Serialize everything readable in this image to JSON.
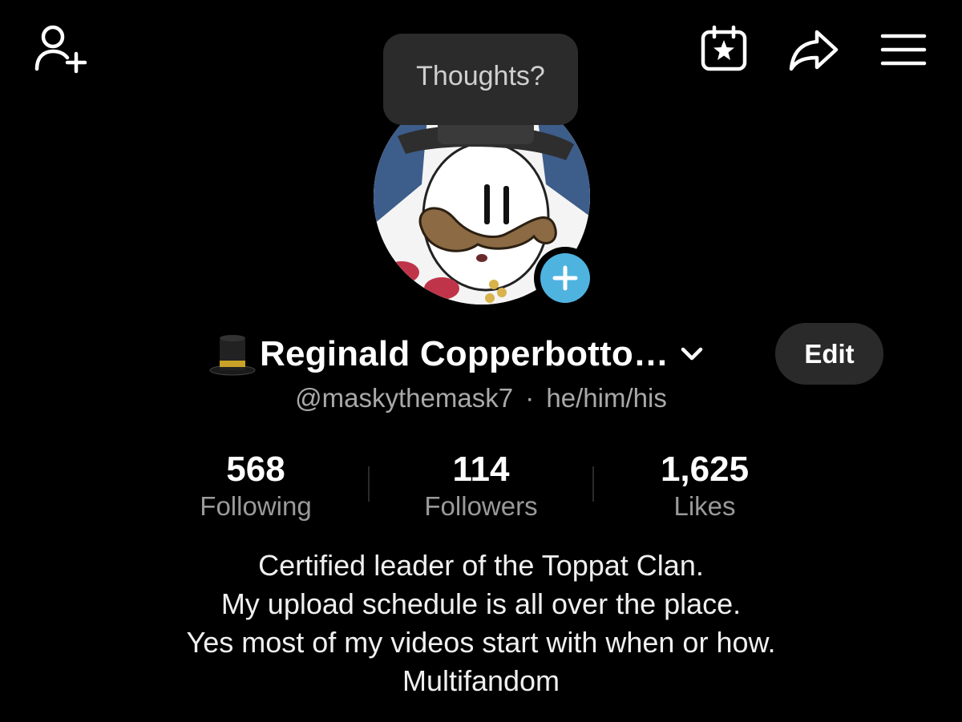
{
  "top_bar": {
    "icons": [
      "add-friend-icon",
      "calendar-star-icon",
      "share-icon",
      "menu-icon"
    ]
  },
  "thoughts_bubble": {
    "text": "Thoughts?"
  },
  "profile": {
    "name": "Reginald Copperbotto…",
    "handle": "@maskythemask7",
    "separator": "·",
    "pronouns": "he/him/his",
    "edit_label": "Edit"
  },
  "stats": [
    {
      "value": "568",
      "label": "Following"
    },
    {
      "value": "114",
      "label": "Followers"
    },
    {
      "value": "1,625",
      "label": "Likes"
    }
  ],
  "bio": [
    "Certified leader of the Toppat Clan.",
    "My upload schedule is all over the place.",
    "Yes most of my videos start with when or how.",
    "Multifandom"
  ],
  "colors": {
    "background": "#000000",
    "accent_plus": "#4fb3e0",
    "bubble": "#2b2b2b",
    "secondary_text": "#a9a9a9"
  }
}
